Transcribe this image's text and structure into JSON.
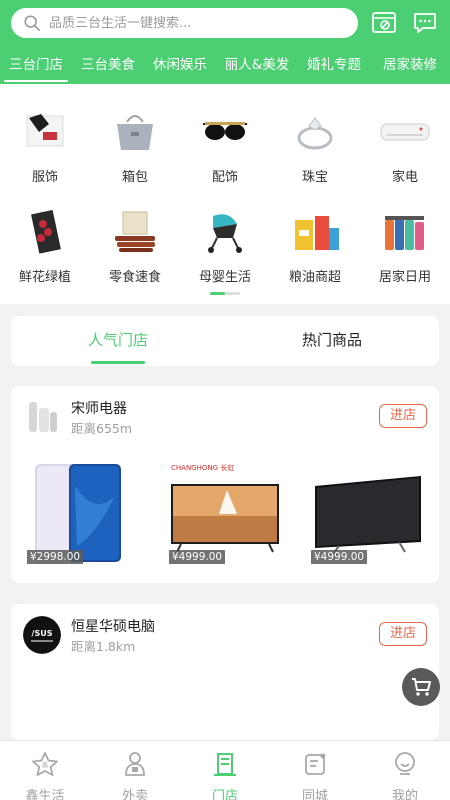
{
  "search": {
    "placeholder": "品质三台生活一键搜索..."
  },
  "header_icons": [
    "scan-icon",
    "message-icon"
  ],
  "tabs": [
    {
      "label": "三台门店",
      "active": true
    },
    {
      "label": "三台美食"
    },
    {
      "label": "休闲娱乐"
    },
    {
      "label": "丽人&美发"
    },
    {
      "label": "婚礼专题"
    },
    {
      "label": "居家装修"
    }
  ],
  "categories": [
    {
      "label": "服饰",
      "icon": "clothing-icon"
    },
    {
      "label": "箱包",
      "icon": "bag-icon"
    },
    {
      "label": "配饰",
      "icon": "sunglasses-icon"
    },
    {
      "label": "珠宝",
      "icon": "ring-icon"
    },
    {
      "label": "家电",
      "icon": "air-conditioner-icon"
    },
    {
      "label": "鲜花绿植",
      "icon": "flower-icon"
    },
    {
      "label": "零食速食",
      "icon": "snack-icon"
    },
    {
      "label": "母婴生活",
      "icon": "stroller-icon"
    },
    {
      "label": "粮油商超",
      "icon": "grocery-icon"
    },
    {
      "label": "居家日用",
      "icon": "bottles-icon"
    }
  ],
  "segment": {
    "popular_stores": "人气门店",
    "hot_products": "热门商品"
  },
  "stores": [
    {
      "name": "宋师电器",
      "distance": "距离655m",
      "enter": "进店",
      "products": [
        {
          "price": "¥2998.00",
          "kind": "phone"
        },
        {
          "price": "¥4999.00",
          "kind": "tv-landscape"
        },
        {
          "price": "¥4999.00",
          "kind": "tv-black"
        }
      ]
    },
    {
      "name": "恒星华硕电脑",
      "distance": "距离1.8km",
      "enter": "进店",
      "logo_text": "/SUS",
      "products": [
        {
          "kind": "poster-yellow"
        },
        {
          "kind": "poster-yellow"
        },
        {
          "kind": "poster-pink"
        }
      ]
    }
  ],
  "bottom_nav": [
    {
      "label": "鑫生活",
      "icon": "star-icon"
    },
    {
      "label": "外卖",
      "icon": "delivery-icon"
    },
    {
      "label": "门店",
      "icon": "store-icon",
      "active": true
    },
    {
      "label": "同城",
      "icon": "city-icon"
    },
    {
      "label": "我的",
      "icon": "profile-icon"
    }
  ],
  "colors": {
    "brand": "#4cce73",
    "accent": "#e4674b"
  }
}
